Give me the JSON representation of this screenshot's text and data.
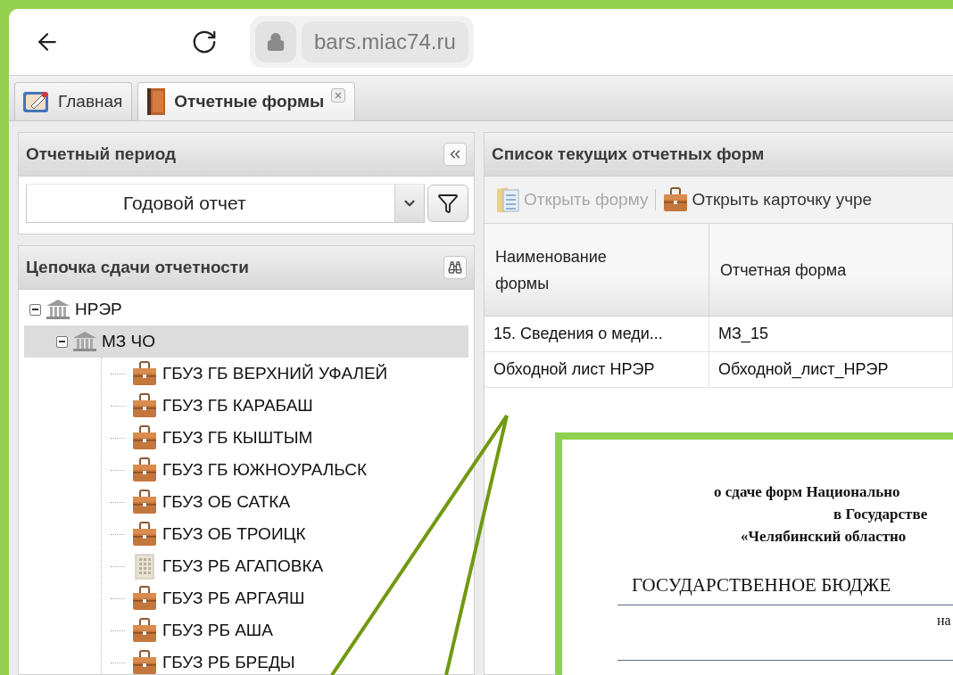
{
  "browser": {
    "url": "bars.miac74.ru"
  },
  "tabs": [
    {
      "label": "Главная",
      "kind": "home",
      "selected": false,
      "closable": false
    },
    {
      "label": "Отчетные формы",
      "kind": "book",
      "selected": true,
      "closable": true
    }
  ],
  "period_panel": {
    "title": "Отчетный период",
    "select": {
      "value": "Годовой отчет"
    }
  },
  "chain_panel": {
    "title": "Цепочка сдачи отчетности",
    "tree": [
      {
        "label": "НРЭР",
        "kind": "institution",
        "expanded": true,
        "selected": false,
        "children": [
          {
            "label": "МЗ ЧО",
            "kind": "institution",
            "expanded": true,
            "selected": true,
            "children": [
              {
                "label": "ГБУЗ ГБ ВЕРХНИЙ УФАЛЕЙ",
                "kind": "briefcase",
                "selected": false
              },
              {
                "label": "ГБУЗ ГБ КАРАБАШ",
                "kind": "briefcase",
                "selected": false
              },
              {
                "label": "ГБУЗ ГБ КЫШТЫМ",
                "kind": "briefcase",
                "selected": false
              },
              {
                "label": "ГБУЗ ГБ ЮЖНОУРАЛЬСК",
                "kind": "briefcase",
                "selected": false
              },
              {
                "label": "ГБУЗ ОБ САТКА",
                "kind": "briefcase",
                "selected": false
              },
              {
                "label": "ГБУЗ ОБ ТРОИЦК",
                "kind": "briefcase",
                "selected": false
              },
              {
                "label": "ГБУЗ РБ АГАПОВКА",
                "kind": "building",
                "selected": false
              },
              {
                "label": "ГБУЗ РБ АРГАЯШ",
                "kind": "briefcase",
                "selected": false
              },
              {
                "label": "ГБУЗ РБ АША",
                "kind": "briefcase",
                "selected": false
              },
              {
                "label": "ГБУЗ РБ БРЕДЫ",
                "kind": "briefcase",
                "selected": false
              }
            ]
          }
        ]
      }
    ]
  },
  "forms_panel": {
    "title": "Список текущих отчетных форм",
    "toolbar": [
      {
        "label": "Открыть форму",
        "kind": "folder",
        "disabled": true
      },
      {
        "label": "Открыть карточку учре",
        "kind": "briefcase",
        "disabled": false
      }
    ],
    "table": {
      "columns": [
        "Наименование формы",
        "Отчетная форма"
      ],
      "rows": [
        [
          "15. Сведения о меди...",
          "МЗ_15"
        ],
        [
          "Обходной лист НРЭР",
          "Обходной_лист_НРЭР"
        ]
      ]
    }
  },
  "callout": {
    "lines": [
      {
        "kind": "title",
        "text": "о сдаче форм Национально"
      },
      {
        "kind": "title",
        "text": "в Государстве"
      },
      {
        "kind": "title",
        "text": "«Челябинский областно"
      },
      {
        "kind": "heading",
        "text": "ГОСУДАРСТВЕННОЕ БЮДЖЕ"
      },
      {
        "kind": "note",
        "text": "на"
      }
    ]
  }
}
